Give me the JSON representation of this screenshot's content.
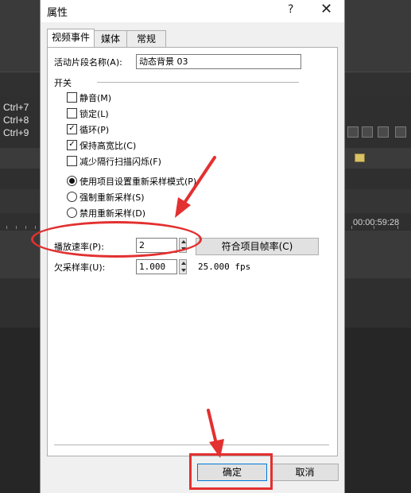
{
  "dialog": {
    "title": "属性",
    "help_glyph": "?",
    "close_glyph": "✕",
    "tabs": [
      {
        "label": "视频事件",
        "active": true
      },
      {
        "label": "媒体",
        "active": false
      },
      {
        "label": "常规",
        "active": false
      }
    ],
    "clip_name_label": "活动片段名称(A):",
    "clip_name_value": "动态背景 03",
    "switches_label": "开关",
    "checkboxes": [
      {
        "label": "静音(M)",
        "checked": false
      },
      {
        "label": "锁定(L)",
        "checked": false
      },
      {
        "label": "循环(P)",
        "checked": true
      },
      {
        "label": "保持高宽比(C)",
        "checked": true
      },
      {
        "label": "减少隔行扫描闪烁(F)",
        "checked": false
      }
    ],
    "radios": [
      {
        "label": "使用项目设置重新采样模式(P)",
        "selected": true
      },
      {
        "label": "强制重新采样(S)",
        "selected": false
      },
      {
        "label": "禁用重新采样(D)",
        "selected": false
      }
    ],
    "playback_rate_label": "播放速率(P):",
    "playback_rate_value": "2",
    "match_rate_button": "符合项目帧率(C)",
    "undersample_label": "欠采样率(U):",
    "undersample_value": "1.000",
    "fps_text": "25.000 fps",
    "ok_button": "确定",
    "cancel_button": "取消"
  },
  "background": {
    "shortcuts": [
      "Ctrl+7",
      "Ctrl+8",
      "Ctrl+9"
    ],
    "timecode": "00:00:59:28"
  },
  "annotation_color": "#e33030",
  "check_glyph": "✓"
}
